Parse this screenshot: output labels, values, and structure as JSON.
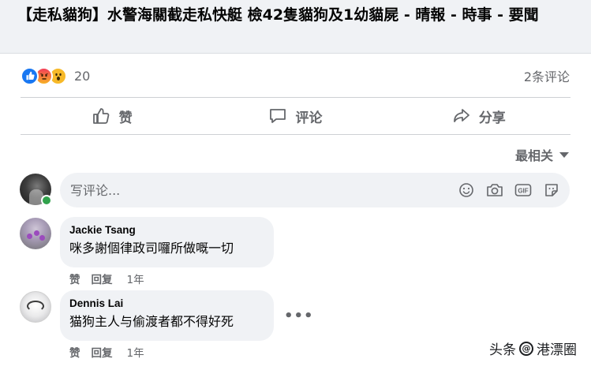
{
  "link": {
    "title": "【走私貓狗】水警海關截走私快艇 檢42隻貓狗及1幼貓屍 - 晴報 - 時事 - 要聞"
  },
  "reactions": {
    "count": "20",
    "types": [
      "like",
      "angry",
      "wow"
    ]
  },
  "comments_count": "2条评论",
  "actions": {
    "like": "赞",
    "comment": "评论",
    "share": "分享"
  },
  "sort_label": "最相关",
  "composer": {
    "placeholder": "写评论..."
  },
  "comments": [
    {
      "author": "Jackie Tsang",
      "text": "咪多謝個律政司囉所做嘅一切",
      "like": "赞",
      "reply": "回复",
      "time": "1年"
    },
    {
      "author": "Dennis Lai",
      "text": "猫狗主人与偷渡者都不得好死",
      "like": "赞",
      "reply": "回复",
      "time": "1年"
    }
  ],
  "watermark": {
    "prefix": "头条",
    "handle": "港漂圈"
  },
  "colors": {
    "like_blue": "#1877f2",
    "grey_text": "#65676b",
    "bubble_bg": "#f0f2f5",
    "online_green": "#31a24c"
  }
}
